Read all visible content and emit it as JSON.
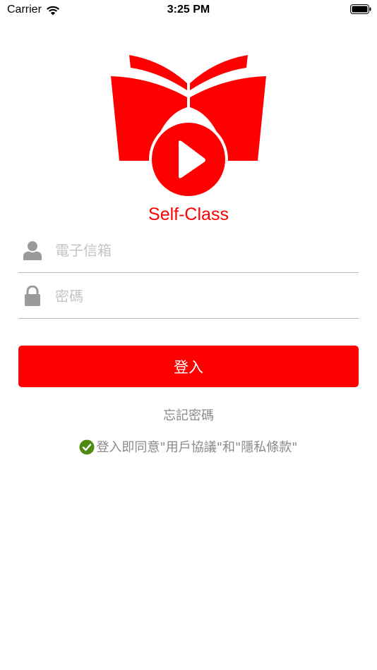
{
  "status_bar": {
    "carrier": "Carrier",
    "time": "3:25 PM"
  },
  "app": {
    "name": "Self-Class",
    "brand_color": "#ff0000"
  },
  "form": {
    "email_placeholder": "電子信箱",
    "password_placeholder": "密碼",
    "email_icon": "user-icon",
    "password_icon": "lock-icon",
    "login_label": "登入",
    "forgot_password_label": "忘記密碼",
    "agreement_text": "登入即同意\"用戶協議\"和\"隱私條款\"",
    "agreement_checked": true,
    "check_color": "#4f8a10"
  }
}
